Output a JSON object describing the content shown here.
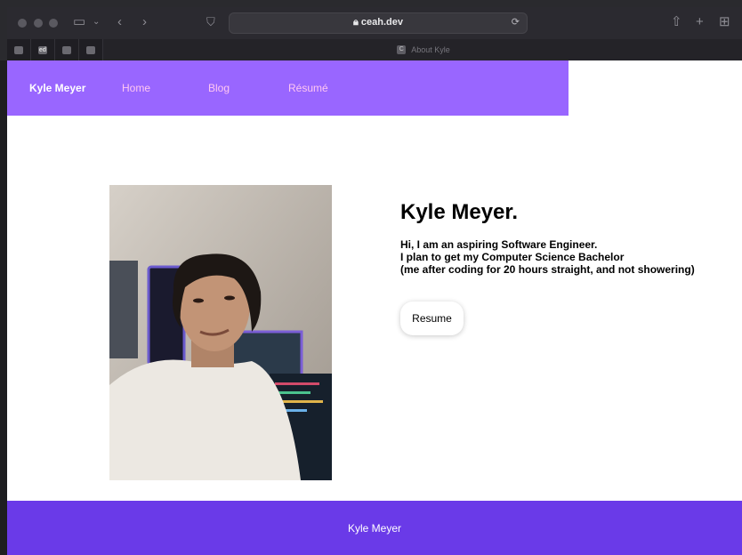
{
  "browser": {
    "url": "ceah.dev",
    "active_tab_title": "About Kyle",
    "pinned_tabs": [
      "",
      "ed",
      "",
      ""
    ]
  },
  "nav": {
    "brand": "Kyle Meyer",
    "links": [
      "Home",
      "Blog",
      "Résumé"
    ]
  },
  "hero": {
    "title": "Kyle Meyer.",
    "bio_lines": [
      "Hi, I am an aspiring Software Engineer.",
      "I plan to get my Computer Science Bachelor",
      "(me after coding for 20 hours straight, and not showering)"
    ],
    "button_label": "Resume"
  },
  "footer": {
    "text": "Kyle Meyer"
  },
  "colors": {
    "nav_bg": "#9966ff",
    "nav_link": "#ffc6f2",
    "footer_bg": "#6a3ae8"
  }
}
